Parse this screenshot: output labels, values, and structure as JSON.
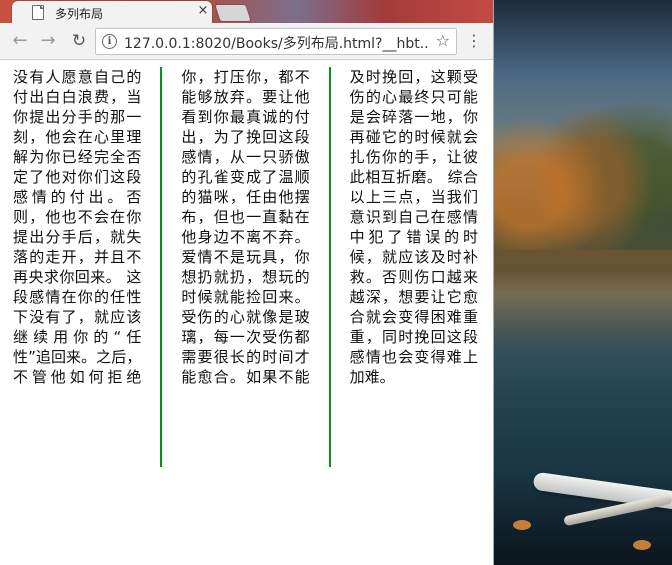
{
  "browser": {
    "tab_title": "多列布局",
    "tab_close": "×",
    "url": "127.0.0.1:8020/Books/多列布局.html?__hbt...",
    "icons": {
      "back": "back-arrow-icon",
      "forward": "forward-arrow-icon",
      "reload": "reload-icon",
      "info": "info-icon",
      "bookmark": "star-icon",
      "menu": "kebab-menu-icon",
      "tab": "document-icon"
    }
  },
  "page": {
    "article": "没有人愿意自己的付出白白浪费，当你提出分手的那一刻，他会在心里理解为你已经完全否定了他对你们这段感情的付出。否则，他也不会在你提出分手后，就失落的走开，并且不再央求你回来。 这段感情在你的任性下没有了，就应该继续用你的“任性”追回来。之后，不管他如何拒绝你，打压你，都不能够放弃。要让他看到你最真诚的付出，为了挽回这段感情，从一只骄傲的孔雀变成了温顺的猫咪，任由他摆布，但也一直黏在他身边不离不弃。 爱情不是玩具，你想扔就扔，想玩的时候就能捡回来。受伤的心就像是玻璃，每一次受伤都需要很长的时间才能愈合。如果不能及时挽回，这颗受伤的心最终只可能是会碎落一地，你再碰它的时候就会扎伤你的手，让彼此相互折磨。 综合以上三点，当我们意识到自己在感情中犯了错误的时候，就应该及时补救。否则伤口越来越深，想要让它愈合就会变得困难重重，同时挽回这段感情也会变得难上加难。",
    "column_rule_color": "#0a8f1c"
  }
}
